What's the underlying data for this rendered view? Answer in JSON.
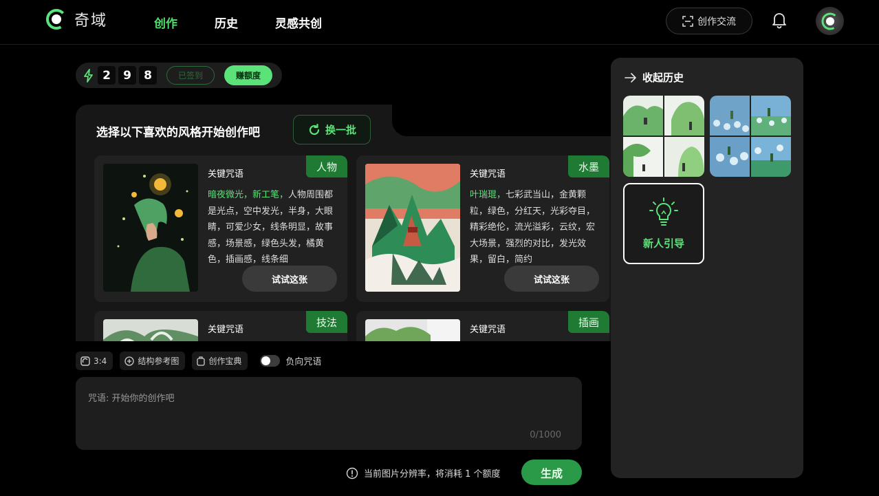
{
  "app": {
    "name": "奇域"
  },
  "nav": {
    "items": [
      {
        "label": "创作",
        "active": true
      },
      {
        "label": "历史",
        "active": false
      },
      {
        "label": "灵感共创",
        "active": false
      }
    ],
    "community_label": "创作交流"
  },
  "credits": {
    "digits": [
      "2",
      "9",
      "8"
    ],
    "signed_label": "已签到",
    "earn_label": "赚额度"
  },
  "styles": {
    "title": "选择以下喜欢的风格开始创作吧",
    "refresh_label": "换一批",
    "cards": [
      {
        "tag": "人物",
        "keyword_label": "关键咒语",
        "highlight": "暗夜微光，新工笔，",
        "description": "人物周围都是光点，空中发光，半身，大眼睛，可爱少女，线条明显，故事感，场景感，绿色头发，橘黄色，插画感，线条细",
        "try_label": "试试这张"
      },
      {
        "tag": "水墨",
        "keyword_label": "关键咒语",
        "highlight": "叶瑞琨，",
        "description": "七彩武当山，金黄颗粒，绿色，分红天，光彩夺目，精彩绝伦，流光溢彩，云纹，宏大场景，强烈的对比，发光效果，留白，简约",
        "try_label": "试试这张"
      },
      {
        "tag": "技法",
        "keyword_label": "关键咒语"
      },
      {
        "tag": "插画",
        "keyword_label": "关键咒语"
      }
    ]
  },
  "toolbar": {
    "ratio": "3:4",
    "structure_label": "结构参考图",
    "guide_label": "创作宝典",
    "negative_label": "负向咒语"
  },
  "prompt": {
    "placeholder": "咒语: 开始你的创作吧",
    "value": "",
    "counter": "0/1000"
  },
  "footer": {
    "notice": "当前图片分辨率，将消耗 1 个额度",
    "generate_label": "生成"
  },
  "history": {
    "collapse_label": "收起历史",
    "guide_label": "新人引导"
  },
  "colors": {
    "accent": "#5be37a",
    "tag_bg": "#1f7a34",
    "generate_bg": "#2a9a49"
  }
}
